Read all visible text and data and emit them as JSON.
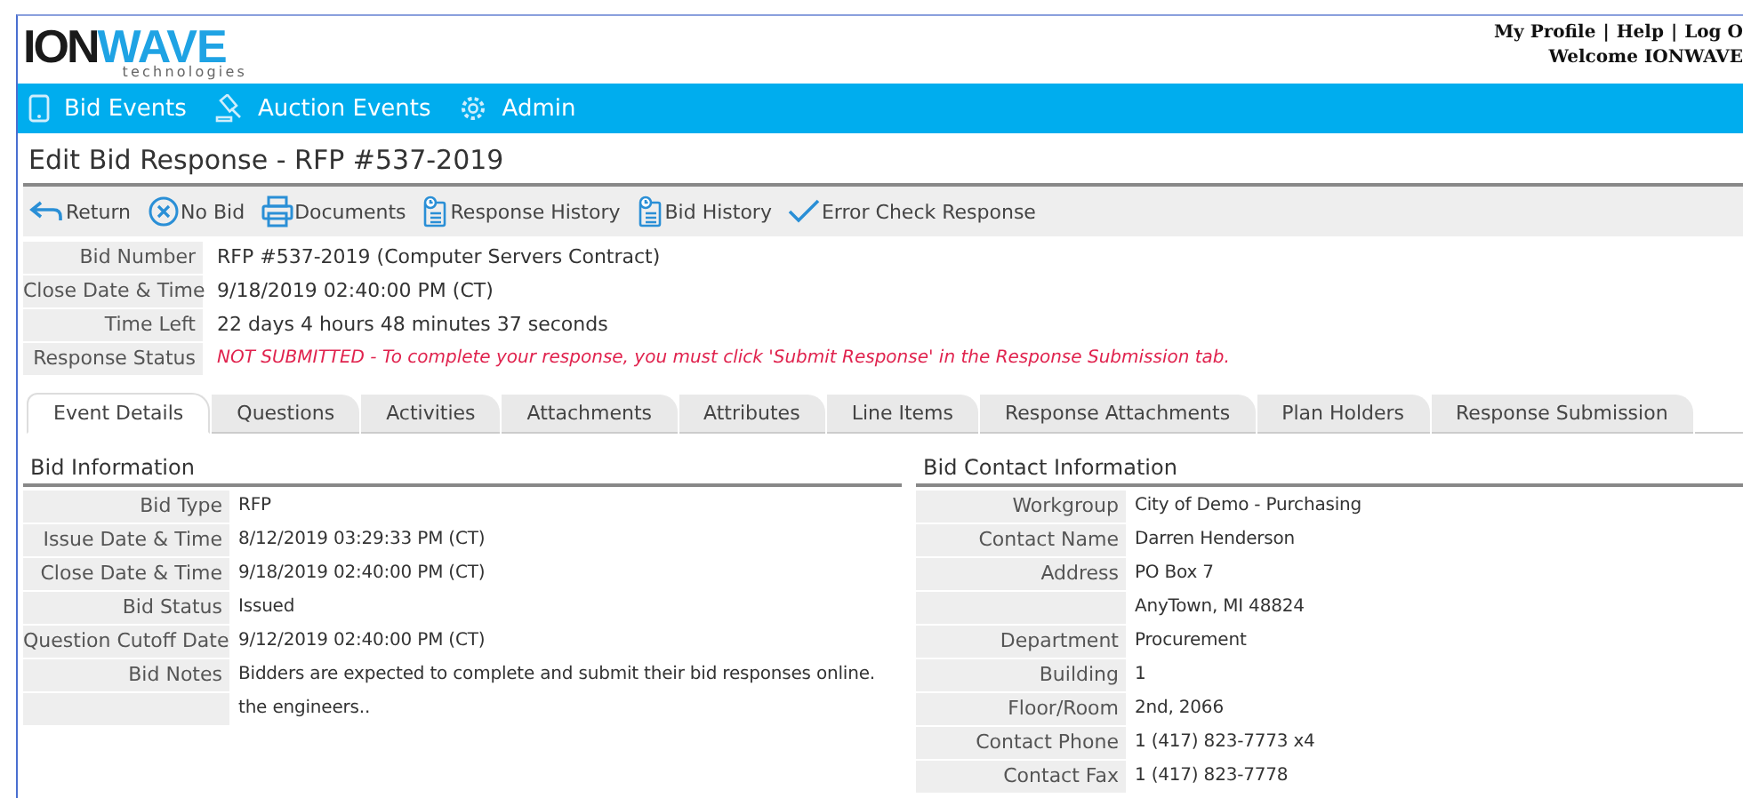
{
  "header": {
    "logo": {
      "brand_left": "ION",
      "brand_right": "WAVE",
      "tagline": "technologies"
    },
    "user_links": [
      "My Profile",
      "Help",
      "Log O"
    ],
    "link_separator": "|",
    "welcome": "Welcome IONWAVE"
  },
  "nav": [
    "Bid Events",
    "Auction Events",
    "Admin"
  ],
  "page_title": "Edit Bid Response - RFP #537-2019",
  "toolbar": [
    "Return",
    "No Bid",
    "Documents",
    "Response History",
    "Bid History",
    "Error Check Response"
  ],
  "summary": [
    {
      "label": "Bid Number",
      "value": "RFP #537-2019 (Computer Servers Contract)",
      "kind": "text"
    },
    {
      "label": "Close Date & Time",
      "value": "9/18/2019 02:40:00 PM (CT)",
      "kind": "text"
    },
    {
      "label": "Time Left",
      "value": "22 days 4 hours 48 minutes 37 seconds",
      "kind": "text"
    },
    {
      "label": "Response Status",
      "value": "NOT SUBMITTED - To complete your response, you must click 'Submit Response' in the Response Submission tab.",
      "kind": "warning"
    }
  ],
  "tabs": [
    {
      "label": "Event Details",
      "selected": true
    },
    {
      "label": "Questions",
      "selected": false
    },
    {
      "label": "Activities",
      "selected": false
    },
    {
      "label": "Attachments",
      "selected": false
    },
    {
      "label": "Attributes",
      "selected": false
    },
    {
      "label": "Line Items",
      "selected": false
    },
    {
      "label": "Response Attachments",
      "selected": false
    },
    {
      "label": "Plan Holders",
      "selected": false
    },
    {
      "label": "Response Submission",
      "selected": false
    }
  ],
  "sections": [
    {
      "title": "Bid Information",
      "rows": [
        {
          "label": "Bid Type",
          "lines": [
            "RFP"
          ]
        },
        {
          "label": "Issue Date & Time",
          "lines": [
            "8/12/2019 03:29:33 PM (CT)"
          ]
        },
        {
          "label": "Close Date & Time",
          "lines": [
            "9/18/2019 02:40:00 PM (CT)"
          ]
        },
        {
          "label": "Bid Status",
          "lines": [
            "Issued"
          ]
        },
        {
          "label": "Question Cutoff Date",
          "lines": [
            "9/12/2019 02:40:00 PM (CT)"
          ]
        },
        {
          "label": "Bid Notes",
          "lines": [
            "Bidders are expected to complete and submit their bid responses online.",
            "the engineers.."
          ]
        }
      ]
    },
    {
      "title": "Bid Contact Information",
      "rows": [
        {
          "label": "Workgroup",
          "lines": [
            "City of Demo - Purchasing"
          ]
        },
        {
          "label": "Contact Name",
          "lines": [
            "Darren Henderson"
          ]
        },
        {
          "label": "Address",
          "lines": [
            "PO Box 7",
            "AnyTown, MI 48824"
          ]
        },
        {
          "label": "Department",
          "lines": [
            "Procurement"
          ]
        },
        {
          "label": "Building",
          "lines": [
            "1"
          ]
        },
        {
          "label": "Floor/Room",
          "lines": [
            "2nd, 2066"
          ]
        },
        {
          "label": "Contact Phone",
          "lines": [
            "1 (417) 823-7773 x4"
          ]
        },
        {
          "label": "Contact Fax",
          "lines": [
            "1 (417) 823-7778"
          ]
        }
      ]
    }
  ]
}
